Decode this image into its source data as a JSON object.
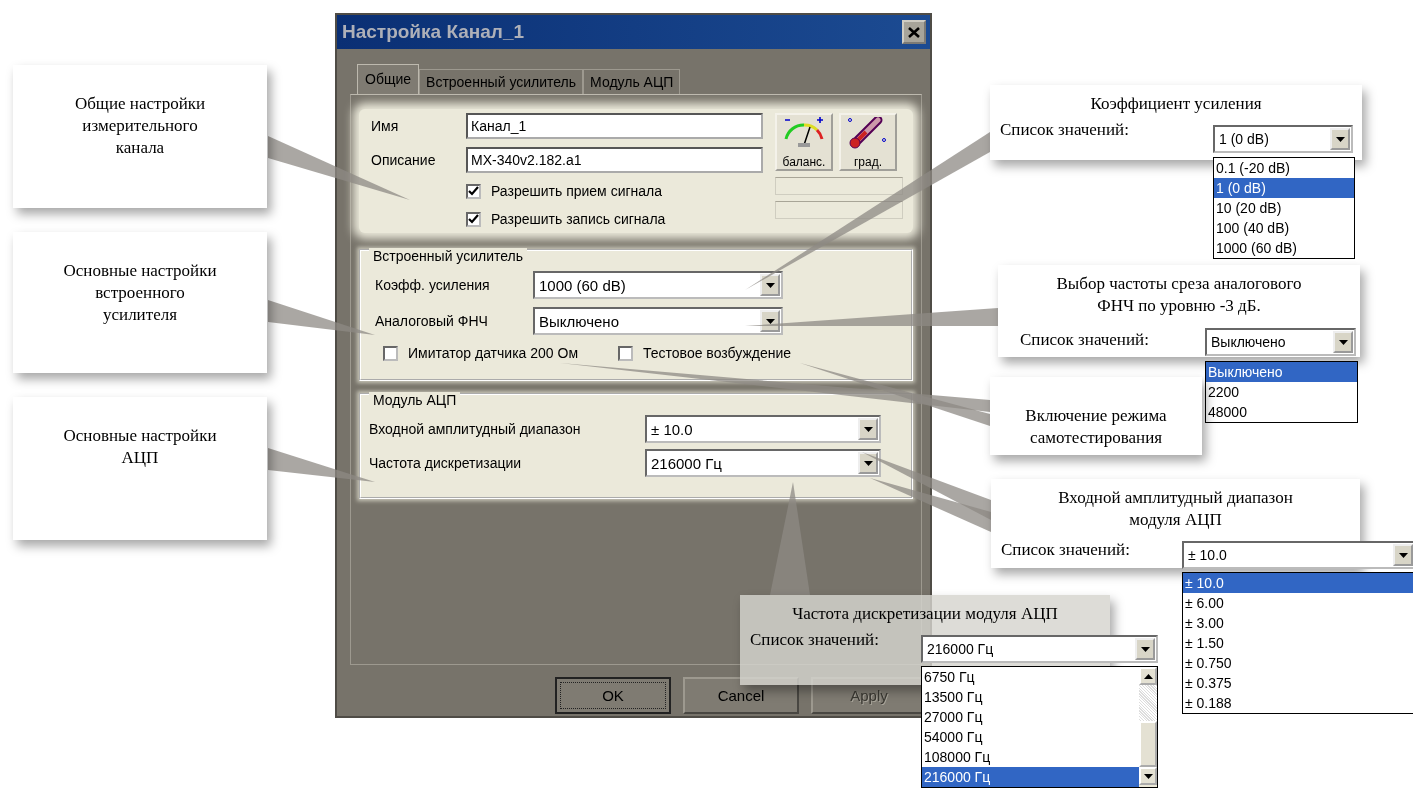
{
  "dialog": {
    "title": "Настройка Канал_1",
    "tabs": [
      {
        "label": "Общие",
        "selected": true
      },
      {
        "label": "Встроенный усилитель",
        "selected": false
      },
      {
        "label": "Модуль АЦП",
        "selected": false
      }
    ],
    "general": {
      "fields": [
        {
          "label": "Имя",
          "value": "Канал_1"
        },
        {
          "label": "Описание",
          "value": "MX-340v2.182.a1"
        }
      ],
      "checks": [
        {
          "label": "Разрешить прием сигнала",
          "checked": true
        },
        {
          "label": "Разрешить запись сигнала",
          "checked": true
        }
      ],
      "tool_buttons": [
        {
          "label": "баланс.",
          "kind": "gauge"
        },
        {
          "label": "град.",
          "kind": "thermometer"
        }
      ]
    },
    "amplifier": {
      "title": "Встроенный усилитель",
      "selects": [
        {
          "label": "Коэфф. усиления",
          "value": "1000 (60 dB)"
        },
        {
          "label": "Аналоговый ФНЧ",
          "value": "Выключено"
        }
      ],
      "checks": [
        {
          "label": "Имитатор датчика 200 Ом",
          "checked": false
        },
        {
          "label": "Тестовое возбуждение",
          "checked": false
        }
      ]
    },
    "adc": {
      "title": "Модуль АЦП",
      "selects": [
        {
          "label": "Входной амплитудный диапазон",
          "value": "± 10.0"
        },
        {
          "label": "Частота дискретизации",
          "value": "216000 Гц"
        }
      ]
    },
    "buttons": [
      {
        "label": "OK",
        "default": true,
        "disabled": false
      },
      {
        "label": "Cancel",
        "default": false,
        "disabled": false
      },
      {
        "label": "Apply",
        "default": false,
        "disabled": true
      }
    ]
  },
  "callouts": [
    {
      "kind": "note",
      "text": "Общие настройки\nизмерительного\nканала"
    },
    {
      "kind": "note",
      "text": "Основные настройки\nвстроенного\nусилителя"
    },
    {
      "kind": "note",
      "text": "Основные настройки\nАЦП"
    },
    {
      "kind": "list",
      "text": "Коэффициент усиления",
      "list_label": "Список значений:",
      "value": "1 (0 dB)",
      "options": [
        {
          "label": "0.1 (-20 dB)",
          "selected": false
        },
        {
          "label": "1 (0 dB)",
          "selected": true
        },
        {
          "label": "10 (20 dB)",
          "selected": false
        },
        {
          "label": "100 (40 dB)",
          "selected": false
        },
        {
          "label": "1000 (60 dB)",
          "selected": false
        }
      ]
    },
    {
      "kind": "list",
      "text": "Выбор частоты среза аналогового\nФНЧ по уровню  -3 дБ.",
      "list_label": "Список значений:",
      "value": "Выключено",
      "options": [
        {
          "label": "Выключено",
          "selected": true
        },
        {
          "label": "2200",
          "selected": false
        },
        {
          "label": "48000",
          "selected": false
        }
      ]
    },
    {
      "kind": "note",
      "text": "Включение режима\nсамотестирования"
    },
    {
      "kind": "list",
      "text": "Входной амплитудный диапазон\nмодуля АЦП",
      "list_label": "Список значений:",
      "value": "± 10.0",
      "options": [
        {
          "label": "± 10.0",
          "selected": true
        },
        {
          "label": "± 6.00",
          "selected": false
        },
        {
          "label": "± 3.00",
          "selected": false
        },
        {
          "label": "± 1.50",
          "selected": false
        },
        {
          "label": "± 0.750",
          "selected": false
        },
        {
          "label": "± 0.375",
          "selected": false
        },
        {
          "label": "± 0.188",
          "selected": false
        }
      ]
    },
    {
      "kind": "list",
      "text": "Частота дискретизации модуля АЦП",
      "list_label": "Список значений:",
      "value": "216000 Гц",
      "scrollable": true,
      "options": [
        {
          "label": "6750 Гц",
          "selected": false
        },
        {
          "label": "13500 Гц",
          "selected": false
        },
        {
          "label": "27000 Гц",
          "selected": false
        },
        {
          "label": "54000 Гц",
          "selected": false
        },
        {
          "label": "108000 Гц",
          "selected": false
        },
        {
          "label": "216000 Гц",
          "selected": true
        }
      ]
    }
  ]
}
